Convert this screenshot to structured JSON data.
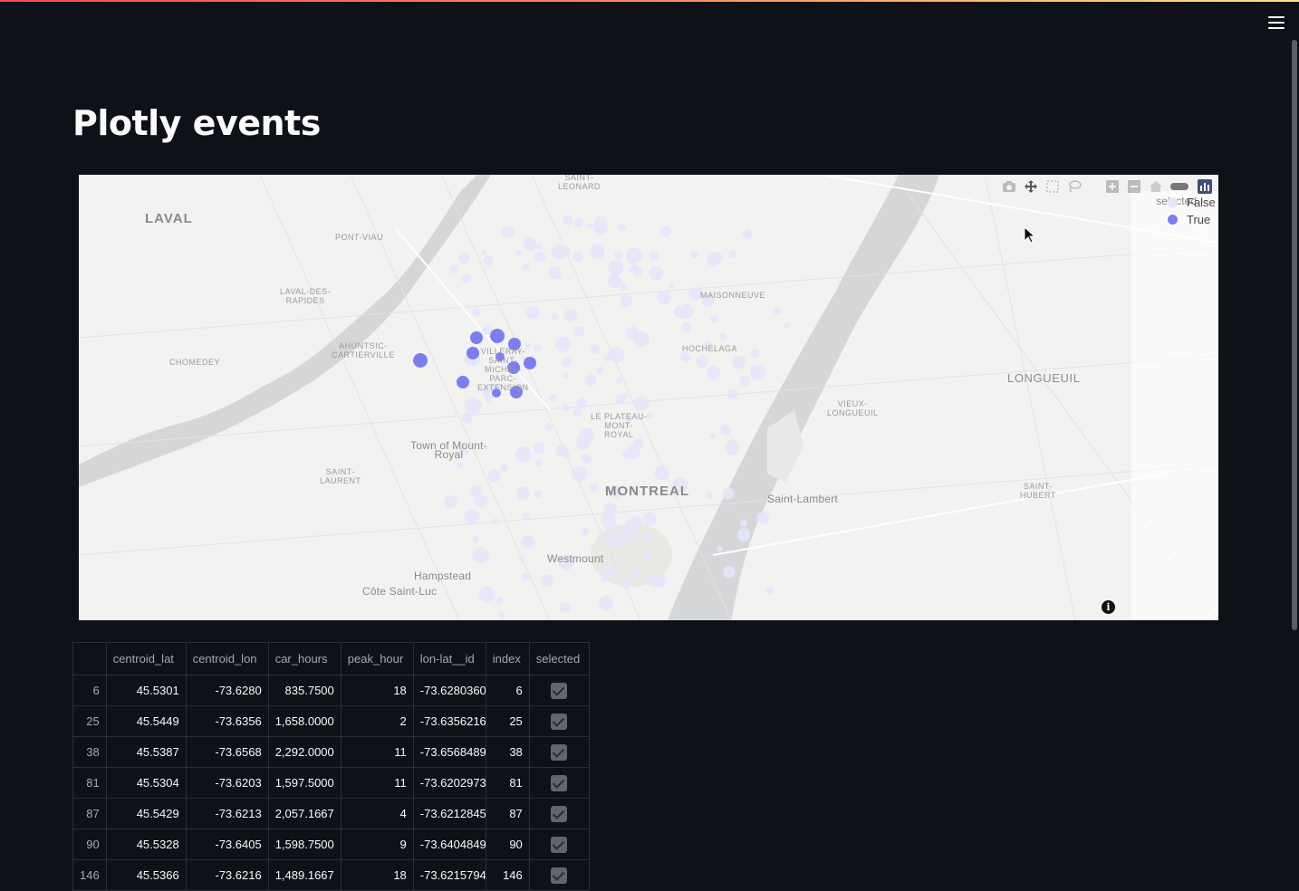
{
  "page": {
    "title": "Plotly events"
  },
  "map": {
    "labels": [
      "LAVAL",
      "PONT-VIAU",
      "LAVAL-DES-\nRAPIDES",
      "CHOMEDEY",
      "AHUNTSIC-\nCARTIERVILLE",
      "SAINT-\nLEONARD",
      "MAISONNEUVE",
      "HOCHELAGA",
      "LONGUEUIL",
      "VIEUX-\nLONGUEUIL",
      "VILLERAY-\nSAINT-\nMICHEL-\nPARC-\nEXTENSION",
      "LE PLATEAU-\nMONT-\nROYAL",
      "Town of Mount-\nRoyal",
      "SAINT-\nLAURENT",
      "MONTREAL",
      "Saint-Lambert",
      "SAINT-\nHUBERT",
      "Westmount",
      "Hampstead",
      "Côte Saint-Luc"
    ]
  },
  "modebar": {
    "icons": [
      "camera-icon",
      "pan-icon",
      "box-select-icon",
      "lasso-icon",
      "zoom-in-icon",
      "zoom-out-icon",
      "reset-icon",
      "plotly-logo-icon"
    ]
  },
  "legend": {
    "title": "selected",
    "items": [
      {
        "label": "False",
        "color": "#e6e6fa"
      },
      {
        "label": "True",
        "color": "#7b7fed"
      }
    ]
  },
  "table": {
    "columns": [
      "",
      "centroid_lat",
      "centroid_lon",
      "car_hours",
      "peak_hour",
      "lon-lat__id",
      "index",
      "selected"
    ],
    "rows": [
      {
        "idx": "6",
        "lat": "45.5301",
        "lon": "-73.6280",
        "car_hours": "835.7500",
        "peak_hour": "18",
        "id": "-73.6280360",
        "index": "6",
        "selected": true
      },
      {
        "idx": "25",
        "lat": "45.5449",
        "lon": "-73.6356",
        "car_hours": "1,658.0000",
        "peak_hour": "2",
        "id": "-73.6356216",
        "index": "25",
        "selected": true
      },
      {
        "idx": "38",
        "lat": "45.5387",
        "lon": "-73.6568",
        "car_hours": "2,292.0000",
        "peak_hour": "11",
        "id": "-73.6568489",
        "index": "38",
        "selected": true
      },
      {
        "idx": "81",
        "lat": "45.5304",
        "lon": "-73.6203",
        "car_hours": "1,597.5000",
        "peak_hour": "11",
        "id": "-73.6202973",
        "index": "81",
        "selected": true
      },
      {
        "idx": "87",
        "lat": "45.5429",
        "lon": "-73.6213",
        "car_hours": "2,057.1667",
        "peak_hour": "4",
        "id": "-73.6212845",
        "index": "87",
        "selected": true
      },
      {
        "idx": "90",
        "lat": "45.5328",
        "lon": "-73.6405",
        "car_hours": "1,598.7500",
        "peak_hour": "9",
        "id": "-73.6404849",
        "index": "90",
        "selected": true
      },
      {
        "idx": "146",
        "lat": "45.5366",
        "lon": "-73.6216",
        "car_hours": "1,489.1667",
        "peak_hour": "18",
        "id": "-73.6215794",
        "index": "146",
        "selected": true
      }
    ]
  }
}
